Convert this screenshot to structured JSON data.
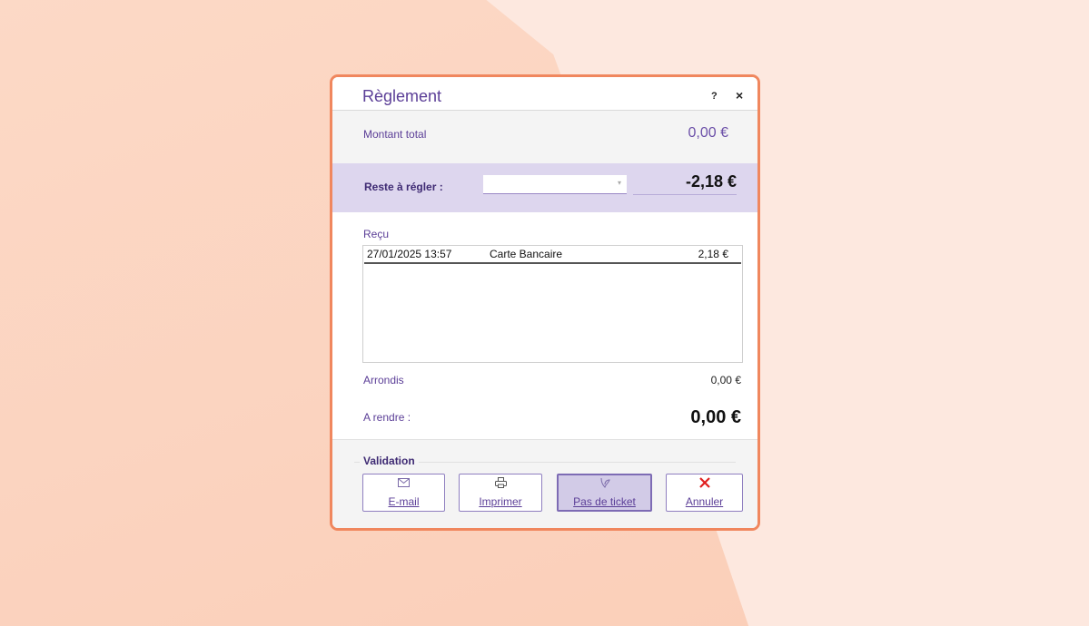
{
  "dialog": {
    "title": "Règlement",
    "help_label": "?",
    "close_label": "×"
  },
  "total": {
    "label": "Montant total",
    "value": "0,00 €"
  },
  "reste": {
    "label": "Reste à régler :",
    "combo_value": "",
    "combo_arrow": "▾",
    "amount": "-2,18 €"
  },
  "recu": {
    "label": "Reçu",
    "rows": [
      {
        "date": "27/01/2025 13:57",
        "mode": "Carte Bancaire",
        "amount": "2,18 €"
      }
    ]
  },
  "arrondis": {
    "label": "Arrondis",
    "value": "0,00  €"
  },
  "rendre": {
    "label": "A rendre :",
    "value": "0,00 €"
  },
  "validation": {
    "label": "Validation",
    "buttons": {
      "email": {
        "label": "E-mail",
        "icon": "envelope-icon"
      },
      "print": {
        "label": "Imprimer",
        "icon": "printer-icon"
      },
      "noticket": {
        "label": "Pas de ticket",
        "icon": "leaf-icon"
      },
      "cancel": {
        "label": "Annuler",
        "icon": "red-x-icon"
      }
    }
  },
  "colors": {
    "accent": "#5b3e97",
    "border": "#f0875e",
    "highlight": "#ddd6ee",
    "cancel_icon": "#e02020"
  }
}
